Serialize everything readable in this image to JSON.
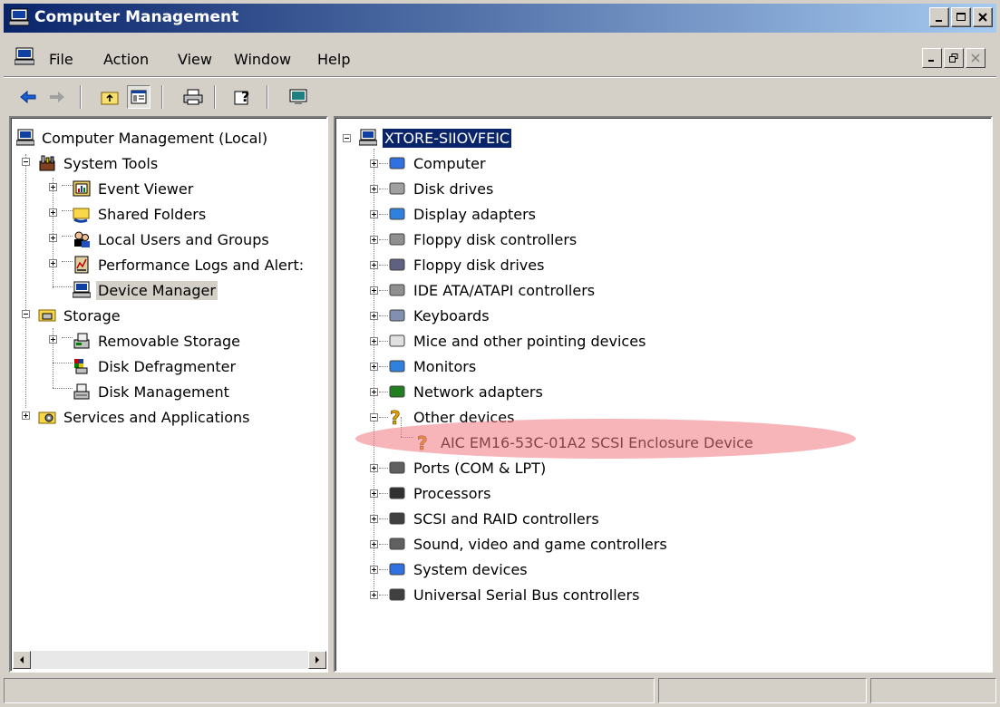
{
  "window": {
    "title": "Computer Management"
  },
  "menu": {
    "items": [
      "File",
      "Action",
      "View",
      "Window",
      "Help"
    ]
  },
  "tree": {
    "root": "Computer Management (Local)",
    "system_tools": "System Tools",
    "event_viewer": "Event Viewer",
    "shared_folders": "Shared Folders",
    "local_users": "Local Users and Groups",
    "perf_logs": "Performance Logs and Alert:",
    "device_manager": "Device Manager",
    "storage": "Storage",
    "removable_storage": "Removable Storage",
    "disk_defrag": "Disk Defragmenter",
    "disk_mgmt": "Disk Management",
    "services": "Services and Applications"
  },
  "devices": {
    "computer_name": "XTORE-SIIOVFEIC",
    "categories": [
      "Computer",
      "Disk drives",
      "Display adapters",
      "Floppy disk controllers",
      "Floppy disk drives",
      "IDE ATA/ATAPI controllers",
      "Keyboards",
      "Mice and other pointing devices",
      "Monitors",
      "Network adapters",
      "Other devices",
      "Ports (COM & LPT)",
      "Processors",
      "SCSI and RAID controllers",
      "Sound, video and game controllers",
      "System devices",
      "Universal Serial Bus controllers"
    ],
    "other_device_child": "AIC EM16-53C-01A2 SCSI Enclosure Device"
  },
  "colors": {
    "title_start": "#0a246a",
    "title_end": "#a6caf0",
    "selection": "#0a246a",
    "highlight": "#f07882"
  }
}
